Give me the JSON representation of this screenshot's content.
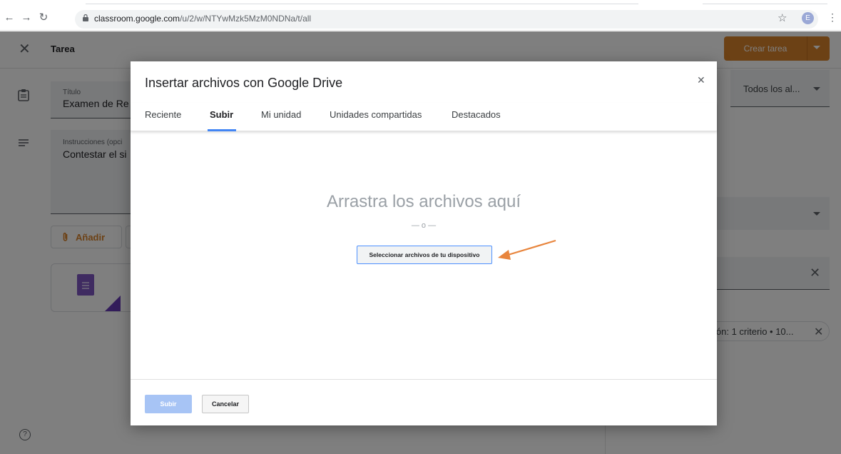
{
  "browser": {
    "url_host": "classroom.google.com",
    "url_path": "/u/2/w/NTYwMzk5MzM0NDNa/t/all",
    "avatar_letter": "E"
  },
  "page": {
    "title": "Tarea",
    "create_button": "Crear tarea",
    "title_field_label": "Título",
    "title_field_value": "Examen de Re",
    "instructions_label": "Instrucciones (opci",
    "instructions_value": "Contestar el si",
    "add_button": "Añadir",
    "assign_select": "Todos los al...",
    "rubric_chip": "ión: 1 criterio • 10..."
  },
  "dialog": {
    "title": "Insertar archivos con Google Drive",
    "tabs": [
      {
        "label": "Reciente"
      },
      {
        "label": "Subir"
      },
      {
        "label": "Mi unidad"
      },
      {
        "label": "Unidades compartidas"
      },
      {
        "label": "Destacados"
      }
    ],
    "active_tab": "Subir",
    "drop_text": "Arrastra los archivos aquí",
    "or_text": "— o —",
    "select_button": "Seleccionar archivos de tu dispositivo",
    "upload_button": "Subir",
    "cancel_button": "Cancelar"
  },
  "colors": {
    "accent_orange": "#d9822b",
    "tab_indicator": "#4285f4",
    "callout_arrow": "#e8853d"
  }
}
